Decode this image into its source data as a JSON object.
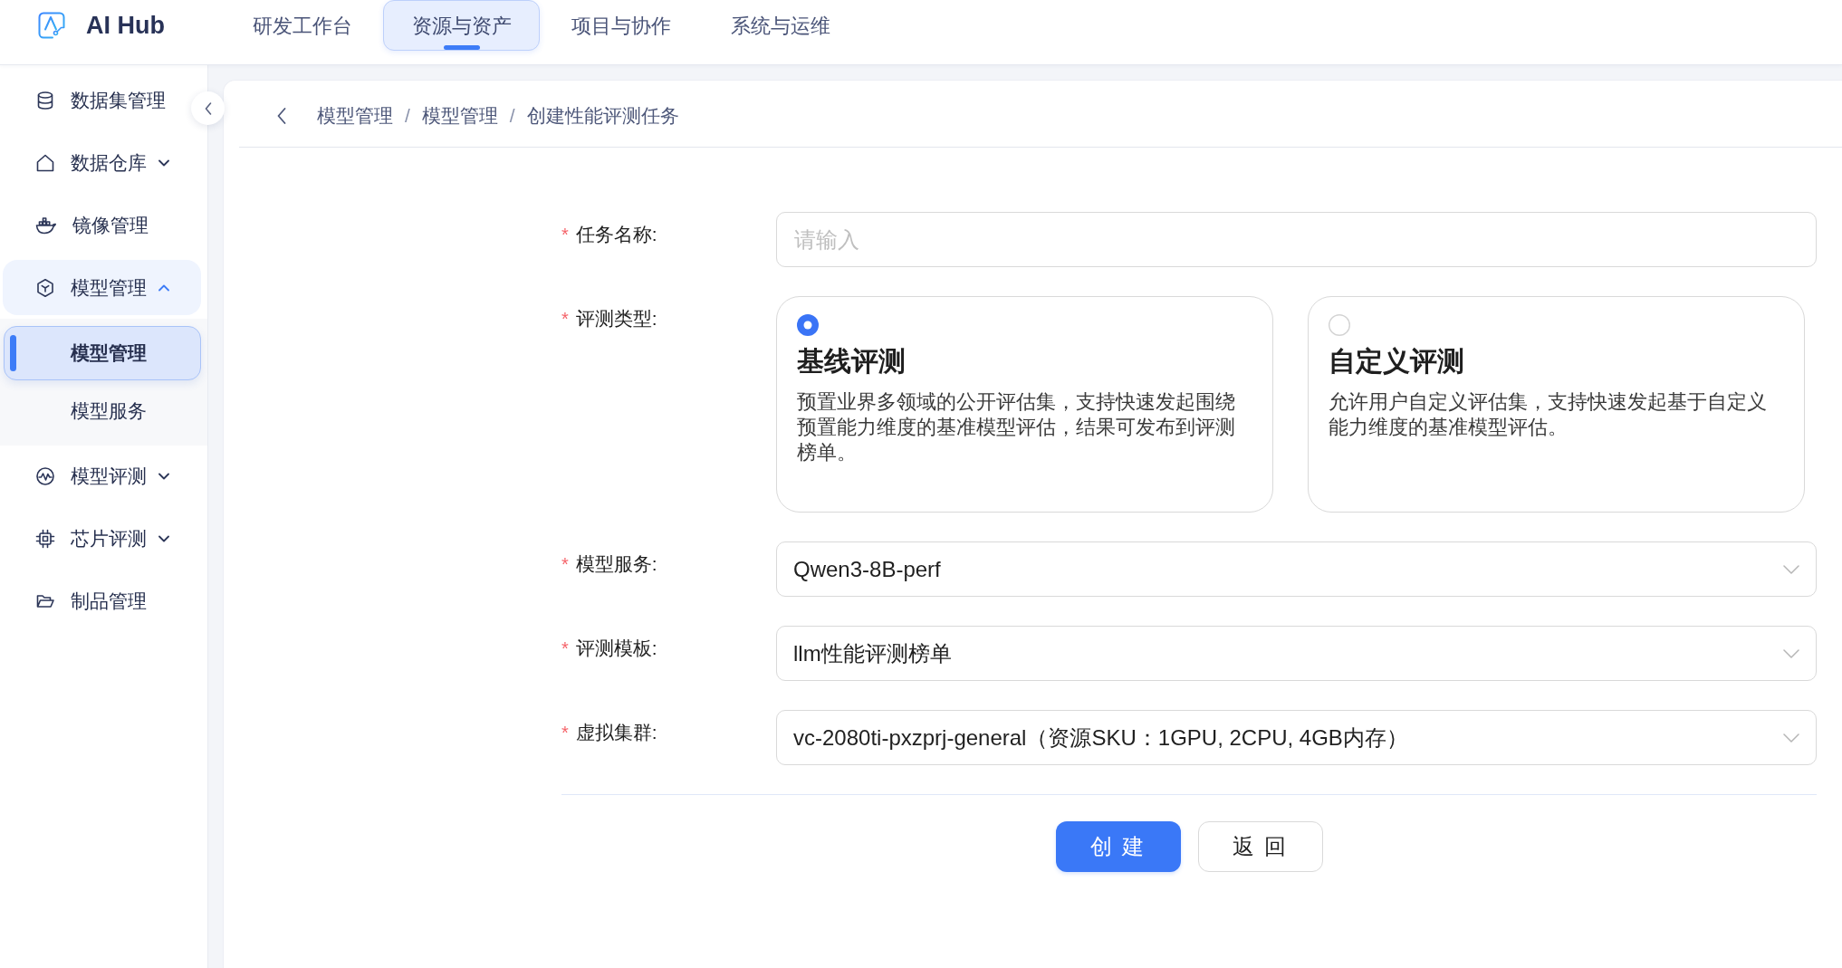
{
  "header": {
    "logo": "AI Hub",
    "tabs": [
      {
        "label": "研发工作台",
        "selected": false
      },
      {
        "label": "资源与资产",
        "selected": true
      },
      {
        "label": "项目与协作",
        "selected": false
      },
      {
        "label": "系统与运维",
        "selected": false
      }
    ]
  },
  "sidebar": {
    "items": [
      {
        "kind": "link",
        "label": "数据集管理",
        "selected": false
      },
      {
        "kind": "group",
        "label": "数据仓库",
        "selected": false,
        "expanded": false
      },
      {
        "kind": "link",
        "label": "镜像管理",
        "selected": false
      },
      {
        "kind": "group",
        "label": "模型管理",
        "selected": true,
        "expanded": true,
        "children": [
          {
            "label": "模型管理",
            "selected": true
          },
          {
            "label": "模型服务",
            "selected": false
          }
        ]
      },
      {
        "kind": "group",
        "label": "模型评测",
        "selected": false,
        "expanded": false
      },
      {
        "kind": "group",
        "label": "芯片评测",
        "selected": false,
        "expanded": false
      },
      {
        "kind": "link",
        "label": "制品管理",
        "selected": false
      }
    ]
  },
  "breadcrumb": {
    "items": [
      {
        "label": "模型管理",
        "separator": "/"
      },
      {
        "label": "模型管理",
        "separator": "/"
      },
      {
        "label": "创建性能评测任务"
      }
    ]
  },
  "form": {
    "fields": [
      {
        "kind": "text",
        "required_mark": "*",
        "label": "任务名称:",
        "placeholder": "请输入"
      },
      {
        "kind": "radio_cards",
        "required_mark": "*",
        "label": "评测类型:",
        "options": [
          {
            "title": "基线评测",
            "description": "预置业界多领域的公开评估集，支持快速发起围绕预置能力维度的基准模型评估，结果可发布到评测榜单。",
            "selected": true
          },
          {
            "title": "自定义评测",
            "description": "允许用户自定义评估集，支持快速发起基于自定义能力维度的基准模型评估。",
            "selected": false
          }
        ]
      },
      {
        "kind": "select",
        "required_mark": "*",
        "label": "模型服务:",
        "value": "Qwen3-8B-perf"
      },
      {
        "kind": "select",
        "required_mark": "*",
        "label": "评测模板:",
        "value": "llm性能评测榜单"
      },
      {
        "kind": "select",
        "required_mark": "*",
        "label": "虚拟集群:",
        "value": "vc-2080ti-pxzprj-general（资源SKU：1GPU, 2CPU, 4GB内存）"
      }
    ],
    "buttons": [
      {
        "kind": "primary",
        "label": "创 建"
      },
      {
        "kind": "default",
        "label": "返 回"
      }
    ]
  }
}
